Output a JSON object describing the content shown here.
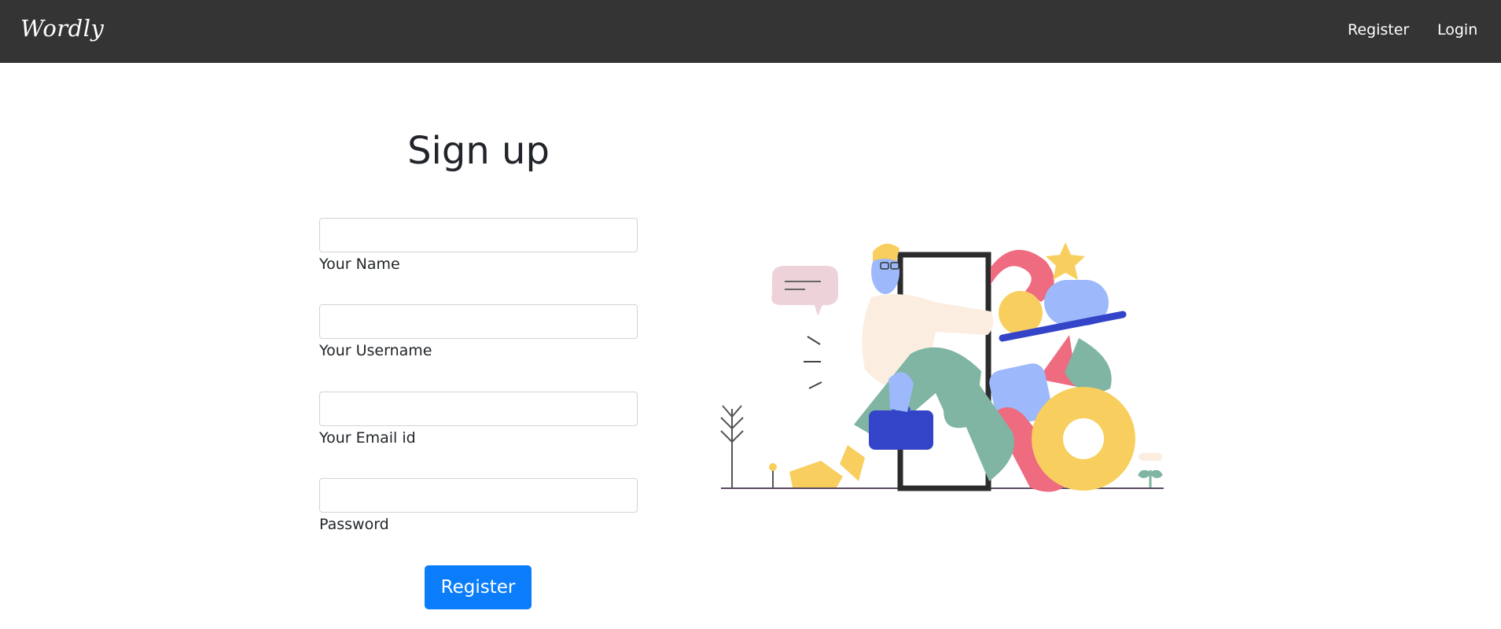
{
  "navbar": {
    "brand": "Wordly",
    "links": {
      "register": "Register",
      "login": "Login"
    }
  },
  "form": {
    "title": "Sign up",
    "fields": [
      {
        "label": "Your Name",
        "value": ""
      },
      {
        "label": "Your Username",
        "value": ""
      },
      {
        "label": "Your Email id",
        "value": ""
      },
      {
        "label": "Password",
        "value": ""
      }
    ],
    "submit_label": "Register"
  },
  "illustration": {
    "icon": "person-entering-door-illustration",
    "colors": {
      "pink": "#ee6b80",
      "yellow": "#f8cf5e",
      "blue": "#9db9fb",
      "green": "#7fb5a2",
      "navy": "#3344c8",
      "skin": "#fbeee0"
    }
  }
}
